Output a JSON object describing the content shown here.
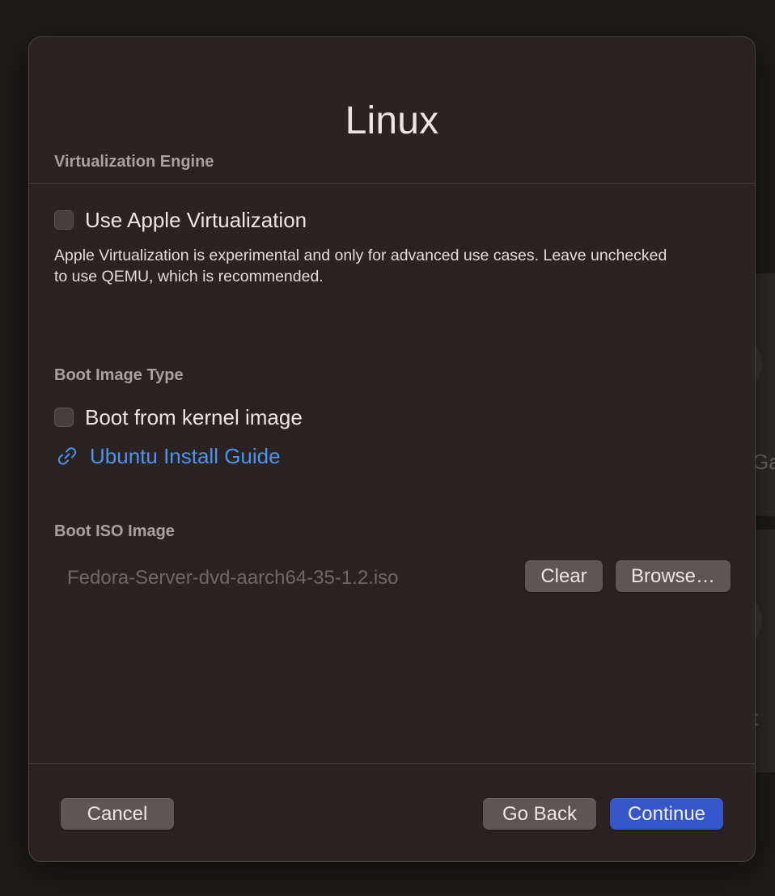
{
  "dialog": {
    "title": "Linux"
  },
  "virtualization": {
    "header": "Virtualization Engine",
    "checkbox_label": "Use Apple Virtualization",
    "checked": false,
    "help_text": "Apple Virtualization is experimental and only for advanced use cases. Leave unchecked to use QEMU, which is recommended."
  },
  "boot_image_type": {
    "header": "Boot Image Type",
    "checkbox_label": "Boot from kernel image",
    "checked": false,
    "link_label": "Ubuntu Install Guide",
    "link_icon": "link-icon"
  },
  "boot_iso": {
    "header": "Boot ISO Image",
    "path": "Fedora-Server-dvd-aarch64-35-1.2.iso",
    "clear_label": "Clear",
    "browse_label": "Browse…"
  },
  "footer": {
    "cancel_label": "Cancel",
    "back_label": "Go Back",
    "continue_label": "Continue"
  },
  "background": {
    "peek_text_1": "Ga",
    "peek_text_2": "t"
  },
  "colors": {
    "accent": "#3556c8",
    "link": "#4b95f0",
    "sheet_background": "#2a2322"
  }
}
